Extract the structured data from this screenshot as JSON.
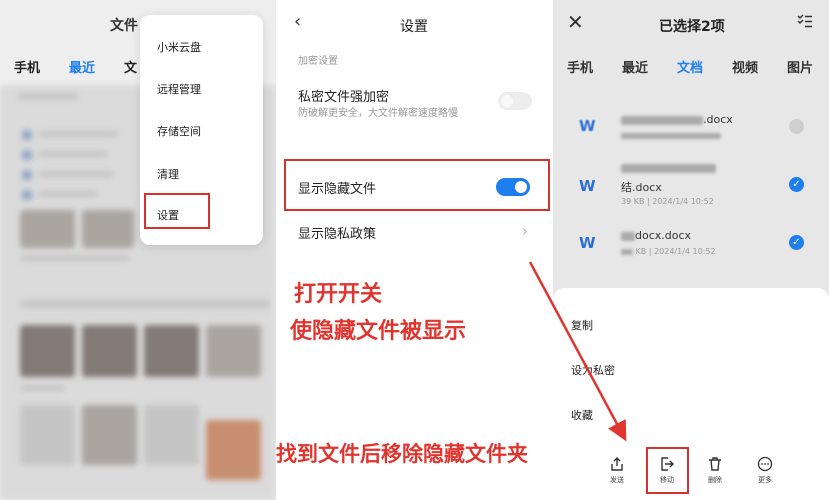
{
  "panel1": {
    "title": "文件",
    "tabs": [
      "手机",
      "最近",
      "文"
    ],
    "menu": [
      "小米云盘",
      "远程管理",
      "存储空间",
      "清理",
      "设置"
    ]
  },
  "panel2": {
    "title": "设置",
    "section_label": "加密设置",
    "rows": [
      {
        "title": "私密文件强加密",
        "subtitle": "防破解更安全，大文件解密速度略慢",
        "toggle": "off"
      },
      {
        "title": "显示隐藏文件",
        "toggle": "on"
      },
      {
        "title": "显示隐私政策"
      }
    ],
    "annotation_line1": "打开开关",
    "annotation_line2": "使隐藏文件被显示",
    "annotation_bottom": "找到文件后移除隐藏文件夹"
  },
  "panel3": {
    "title": "已选择2项",
    "tabs": [
      "手机",
      "最近",
      "文档",
      "视频",
      "图片"
    ],
    "files": [
      {
        "name_suffix": ".docx",
        "line2": "",
        "meta": "",
        "checked": false
      },
      {
        "name_suffix": "",
        "line2": "结.docx",
        "meta": "39 KB | 2024/1/4 10:52",
        "checked": true
      },
      {
        "name_suffix": "docx.docx",
        "line2": "",
        "meta": "KB | 2024/1/4 10:52",
        "checked": true
      }
    ],
    "sheet": [
      "复制",
      "设为私密",
      "收藏"
    ],
    "bottom_bar": [
      "发送",
      "移动",
      "删除",
      "更多"
    ]
  },
  "colors": {
    "accent": "#1e7ef0",
    "annotation": "#e0352f"
  }
}
